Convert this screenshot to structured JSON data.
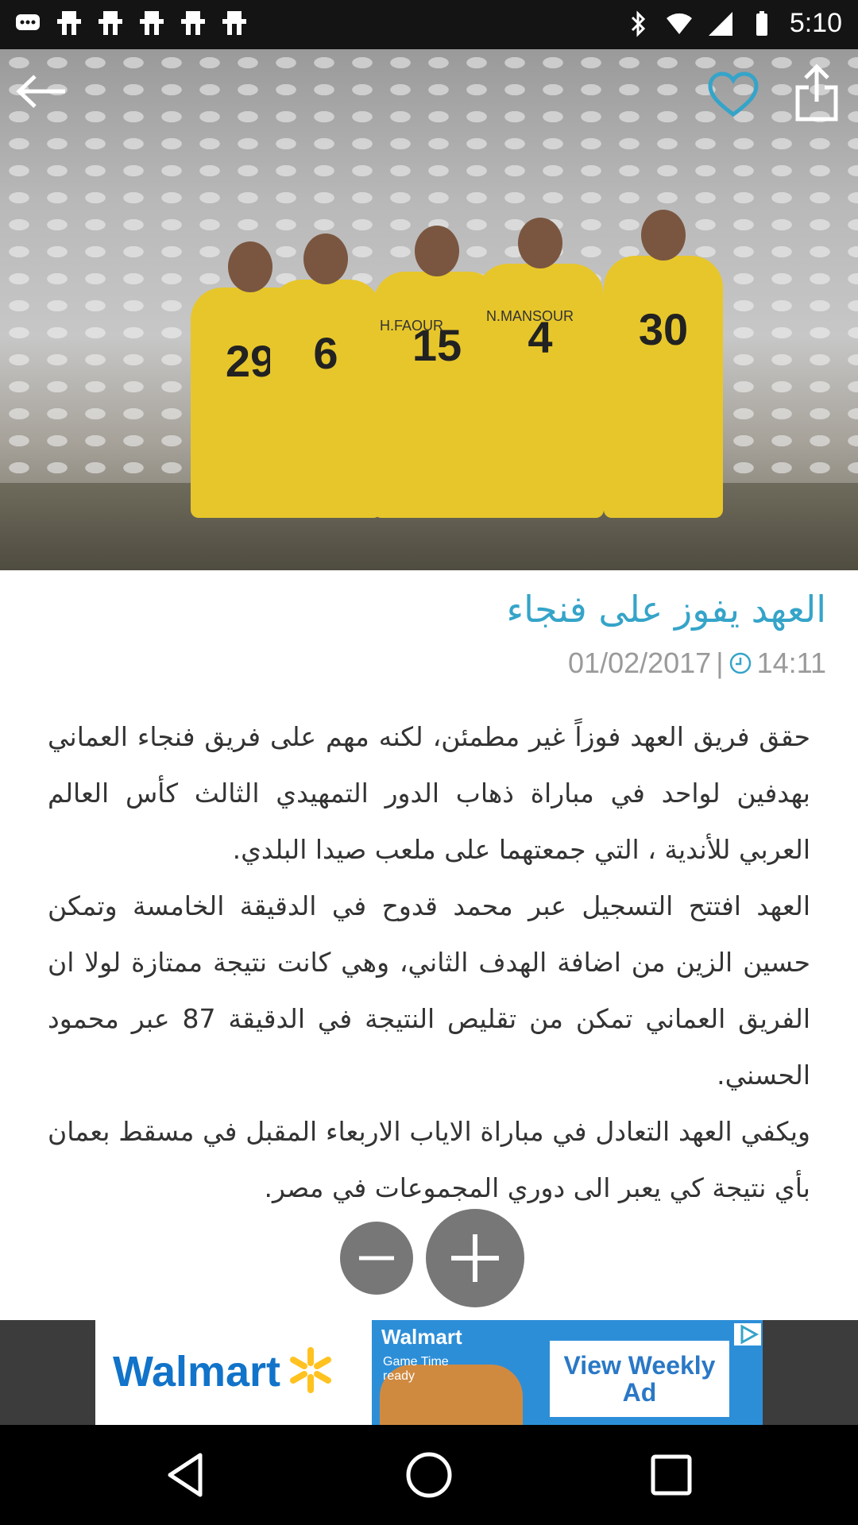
{
  "status_bar": {
    "time": "5:10",
    "left_icons": [
      "messaging-icon",
      "notification-icon",
      "notification-icon",
      "notification-icon",
      "notification-icon",
      "notification-icon"
    ],
    "right_icons": [
      "bluetooth-icon",
      "wifi-icon",
      "signal-icon",
      "battery-icon"
    ]
  },
  "header": {
    "back_icon": "arrow-left-icon",
    "favorite_icon": "heart-icon",
    "share_icon": "share-icon",
    "favorite_color": "#35a4c9"
  },
  "hero": {
    "jersey_numbers": [
      "29",
      "6",
      "15",
      "4",
      "30"
    ],
    "jersey_names": [
      "H.FAOUR",
      "N.MANSOUR"
    ]
  },
  "article": {
    "title": "العهد يفوز على فنجاء",
    "date": "01/02/2017",
    "separator": "|",
    "time": "14:11",
    "paragraphs": [
      "حقق فريق العهد فوزاً غير مطمئن، لكنه مهم على فريق فنجاء العماني بهدفين لواحد في مباراة ذهاب الدور التمهيدي الثالث كأس العالم العربي للأندية ، التي جمعتهما على ملعب صيدا البلدي.",
      "العهد افتتح التسجيل عبر محمد قدوح في الدقيقة الخامسة وتمكن حسين الزين من اضافة الهدف الثاني، وهي كانت نتيجة ممتازة لولا ان الفريق العماني تمكن من تقليص النتيجة في الدقيقة 87 عبر محمود الحسني.",
      "ويكفي العهد التعادل في مباراة الاياب الاربعاء المقبل في مسقط بعمان بأي نتيجة كي يعبر الى دوري المجموعات في مصر."
    ],
    "title_color": "#35a4c9"
  },
  "zoom": {
    "zoom_out_icon": "minus-icon",
    "zoom_in_icon": "plus-icon"
  },
  "ad": {
    "brand": "Walmart",
    "banner_brand": "Walmart",
    "banner_sub": "Game Time ready",
    "cta": "View Weekly Ad",
    "brand_color": "#1173c9",
    "spark_color": "#ffc220"
  },
  "nav": {
    "back_icon": "triangle-back-icon",
    "home_icon": "circle-home-icon",
    "recents_icon": "square-recents-icon"
  }
}
